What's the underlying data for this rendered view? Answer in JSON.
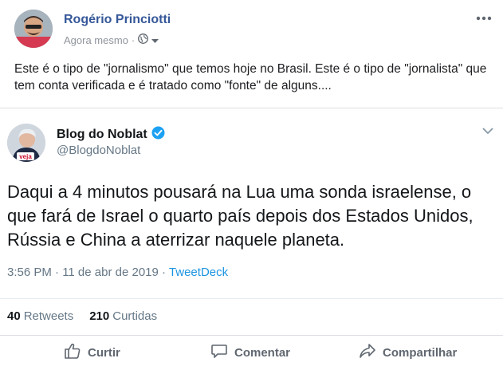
{
  "post": {
    "author": "Rogério Princiotti",
    "time": "Agora mesmo",
    "dot": "·",
    "text": "Este é o tipo de \"jornalismo\" que temos hoje no Brasil. Este é o tipo de \"jornalista\" que tem conta verificada e é tratado como \"fonte\" de alguns...."
  },
  "tweet": {
    "name": "Blog do Noblat",
    "handle": "@BlogdoNoblat",
    "text": "Daqui a 4 minutos pousará na Lua uma sonda israelense, o que fará de Israel o quarto país depois dos Estados Unidos, Rússia e China a aterrizar naquele planeta.",
    "timestamp": "3:56 PM · 11 de abr de 2019 · ",
    "source": "TweetDeck",
    "avatar_badge": "veja",
    "retweets": "40",
    "retweets_label": "Retweets",
    "likes": "210",
    "likes_label": "Curtidas"
  },
  "actions": {
    "like": "Curtir",
    "comment": "Comentar",
    "share": "Compartilhar"
  },
  "colors": {
    "fb_link": "#365899",
    "twitter_blue": "#1da1f2",
    "muted": "#90949c"
  }
}
